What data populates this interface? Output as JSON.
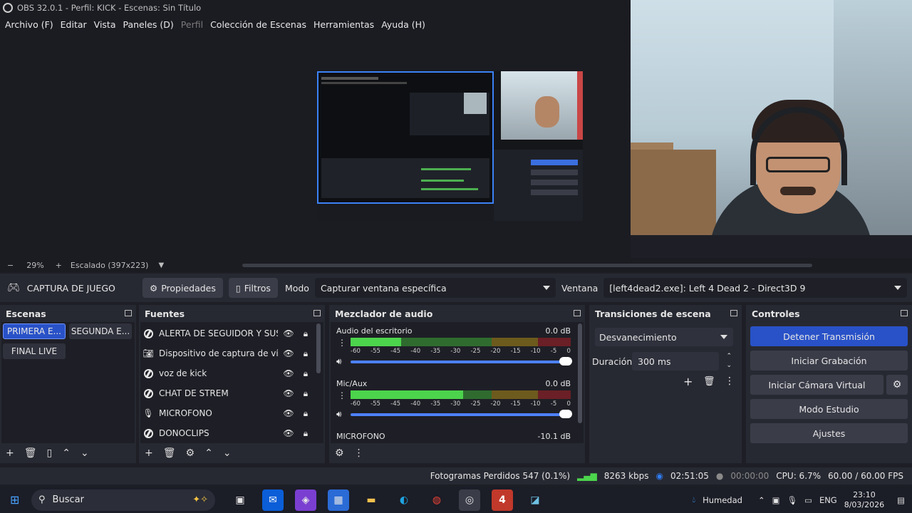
{
  "window": {
    "title": "OBS 32.0.1 - Perfil: KICK - Escenas: Sin Título"
  },
  "menu": {
    "items": [
      {
        "label": "Archivo (F)",
        "disabled": false
      },
      {
        "label": "Editar",
        "disabled": false
      },
      {
        "label": "Vista",
        "disabled": false
      },
      {
        "label": "Paneles (D)",
        "disabled": false
      },
      {
        "label": "Perfil",
        "disabled": true
      },
      {
        "label": "Colección de Escenas",
        "disabled": false
      },
      {
        "label": "Herramientas",
        "disabled": false
      },
      {
        "label": "Ayuda (H)",
        "disabled": false
      }
    ]
  },
  "zoom": {
    "minus": "−",
    "level": "29%",
    "plus": "+",
    "scaling": "Escalado (397x223)"
  },
  "source_toolbar": {
    "source_name": "CAPTURA DE JUEGO",
    "properties_label": "Propiedades",
    "filters_label": "Filtros",
    "mode_label": "Modo",
    "mode_value": "Capturar ventana específica",
    "window_label": "Ventana",
    "window_value": "[left4dead2.exe]: Left 4 Dead 2 - Direct3D 9"
  },
  "scenes": {
    "title": "Escenas",
    "items": [
      "PRIMERA E...",
      "SEGUNDA E...",
      "FINAL LIVE"
    ]
  },
  "sources": {
    "title": "Fuentes",
    "items": [
      {
        "label": "ALERTA DE SEGUIDOR Y SUSC",
        "icon": "globe-icon"
      },
      {
        "label": "Dispositivo de captura de vídeo",
        "icon": "camera-icon"
      },
      {
        "label": "voz de kick",
        "icon": "globe-icon"
      },
      {
        "label": "CHAT DE STREM",
        "icon": "globe-icon"
      },
      {
        "label": "MICROFONO",
        "icon": "microphone-icon"
      },
      {
        "label": "DONOCLIPS",
        "icon": "globe-icon"
      }
    ]
  },
  "mixer": {
    "title": "Mezclador de audio",
    "channels": [
      {
        "name": "Audio del escritorio",
        "db": "0.0 dB",
        "level_pct": 23
      },
      {
        "name": "Mic/Aux",
        "db": "0.0 dB",
        "level_pct": 51
      },
      {
        "name": "MICROFONO",
        "db": "-10.1 dB",
        "level_pct": 0
      }
    ],
    "scale": [
      "-60",
      "-55",
      "-45",
      "-40",
      "-35",
      "-30",
      "-25",
      "-20",
      "-15",
      "-10",
      "-5",
      "0"
    ]
  },
  "transitions": {
    "title": "Transiciones de escena",
    "selected": "Desvanecimiento",
    "duration_label": "Duración",
    "duration_value": "300 ms"
  },
  "controls": {
    "title": "Controles",
    "stop_stream": "Detener Transmisión",
    "start_recording": "Iniciar Grabación",
    "start_vcam": "Iniciar Cámara Virtual",
    "studio_mode": "Modo Estudio",
    "settings": "Ajustes"
  },
  "status": {
    "dropped_frames": "Fotogramas Perdidos 547 (0.1%)",
    "bitrate": "8263 kbps",
    "stream_time": "02:51:05",
    "rec_time": "00:00:00",
    "cpu": "CPU: 6.7%",
    "fps": "60.00 / 60.00 FPS"
  },
  "taskbar": {
    "search_placeholder": "Buscar",
    "weather": "Humedad",
    "language": "ENG",
    "time": "23:10",
    "date": "8/03/2026",
    "l4d_label": "4"
  },
  "colors": {
    "accent": "#2952c8",
    "meter_green": "#4cd44c",
    "meter_yellow": "#e0b42c",
    "meter_red": "#c62828"
  }
}
